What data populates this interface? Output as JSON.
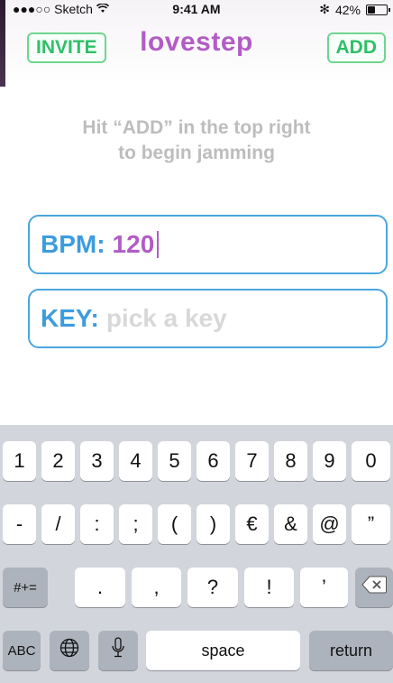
{
  "status_bar": {
    "carrier": "●●●○○ Sketch",
    "time": "9:41 AM",
    "bluetooth": "✻",
    "battery_text": "42%",
    "battery_level": 0.42,
    "icons": [
      "signal-dots-icon",
      "wifi-icon",
      "bluetooth-icon",
      "battery-icon"
    ]
  },
  "nav": {
    "invite_label": "INVITE",
    "title": "lovestep",
    "add_label": "ADD"
  },
  "hint": {
    "line1": "Hit “ADD” in the top right",
    "line2": "to begin jamming"
  },
  "fields": {
    "bpm": {
      "label": "BPM:",
      "value": "120"
    },
    "key": {
      "label": "KEY:",
      "placeholder": "pick a key"
    }
  },
  "keyboard": {
    "row1": [
      "1",
      "2",
      "3",
      "4",
      "5",
      "6",
      "7",
      "8",
      "9",
      "0"
    ],
    "row2": [
      "-",
      "/",
      ":",
      ";",
      "(",
      ")",
      "€",
      "&",
      "@",
      "”"
    ],
    "row3": {
      "toggle": "#+=",
      "keys": [
        ".",
        ",",
        "?",
        "!",
        "’"
      ],
      "backspace_icon": "⌫"
    },
    "row4": {
      "abc": "ABC",
      "globe_icon": "🌐",
      "mic_icon": "🎤",
      "space": "space",
      "return": "return"
    }
  },
  "colors": {
    "accent_green": "#2fbf68",
    "title_purple": "#b25cc6",
    "field_blue": "#3c9cde",
    "hint_gray": "#bdbdbd",
    "keyboard_bg": "#d2d5db"
  }
}
